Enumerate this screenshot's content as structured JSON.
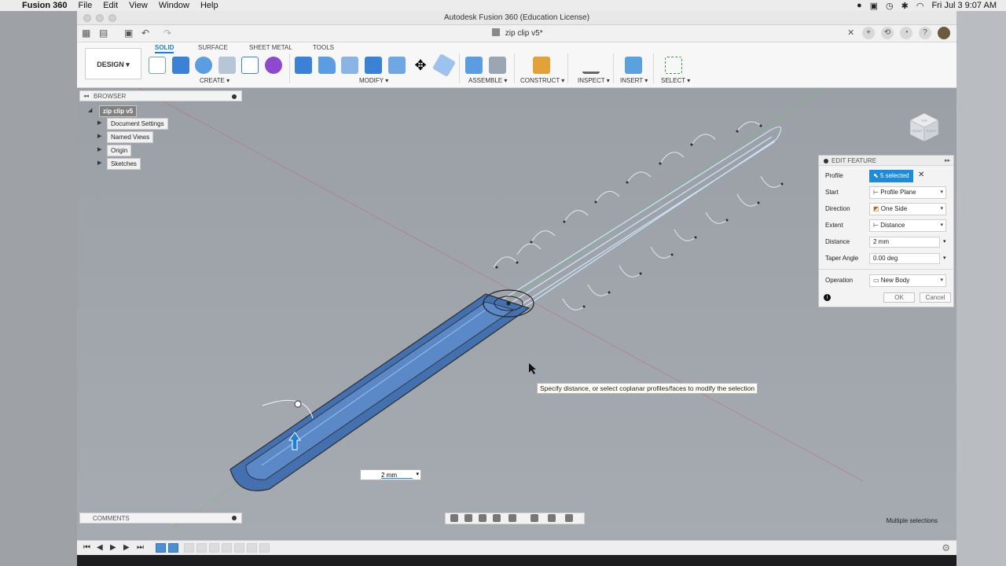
{
  "menubar": {
    "app": "Fusion 360",
    "menus": [
      "File",
      "Edit",
      "View",
      "Window",
      "Help"
    ],
    "clock": "Fri Jul 3  9:07 AM"
  },
  "window": {
    "title": "Autodesk Fusion 360 (Education License)",
    "document_tab": "zip clip v5*"
  },
  "toolbar": {
    "workspace": "DESIGN",
    "tabs": [
      "SOLID",
      "SURFACE",
      "SHEET METAL",
      "TOOLS"
    ],
    "groups": [
      "CREATE",
      "MODIFY",
      "ASSEMBLE",
      "CONSTRUCT",
      "INSPECT",
      "INSERT",
      "SELECT"
    ]
  },
  "browser": {
    "title": "BROWSER",
    "root": "zip clip v5",
    "items": [
      "Document Settings",
      "Named Views",
      "Origin",
      "Sketches"
    ]
  },
  "edit_feature": {
    "title": "EDIT FEATURE",
    "rows": [
      {
        "label": "Profile",
        "value": "5 selected"
      },
      {
        "label": "Start",
        "value": "Profile Plane"
      },
      {
        "label": "Direction",
        "value": "One Side"
      },
      {
        "label": "Extent",
        "value": "Distance"
      },
      {
        "label": "Distance",
        "value": "2 mm"
      },
      {
        "label": "Taper Angle",
        "value": "0.00 deg"
      },
      {
        "label": "Operation",
        "value": "New Body"
      }
    ],
    "ok": "OK",
    "cancel": "Cancel"
  },
  "tooltip": "Specify distance, or select coplanar profiles/faces to modify the selection",
  "dimension_input": "2 mm",
  "comments": "COMMENTS",
  "status": "Multiple selections",
  "viewcube": {
    "top": "TOP",
    "front": "FRONT",
    "right": "RIGHT"
  }
}
